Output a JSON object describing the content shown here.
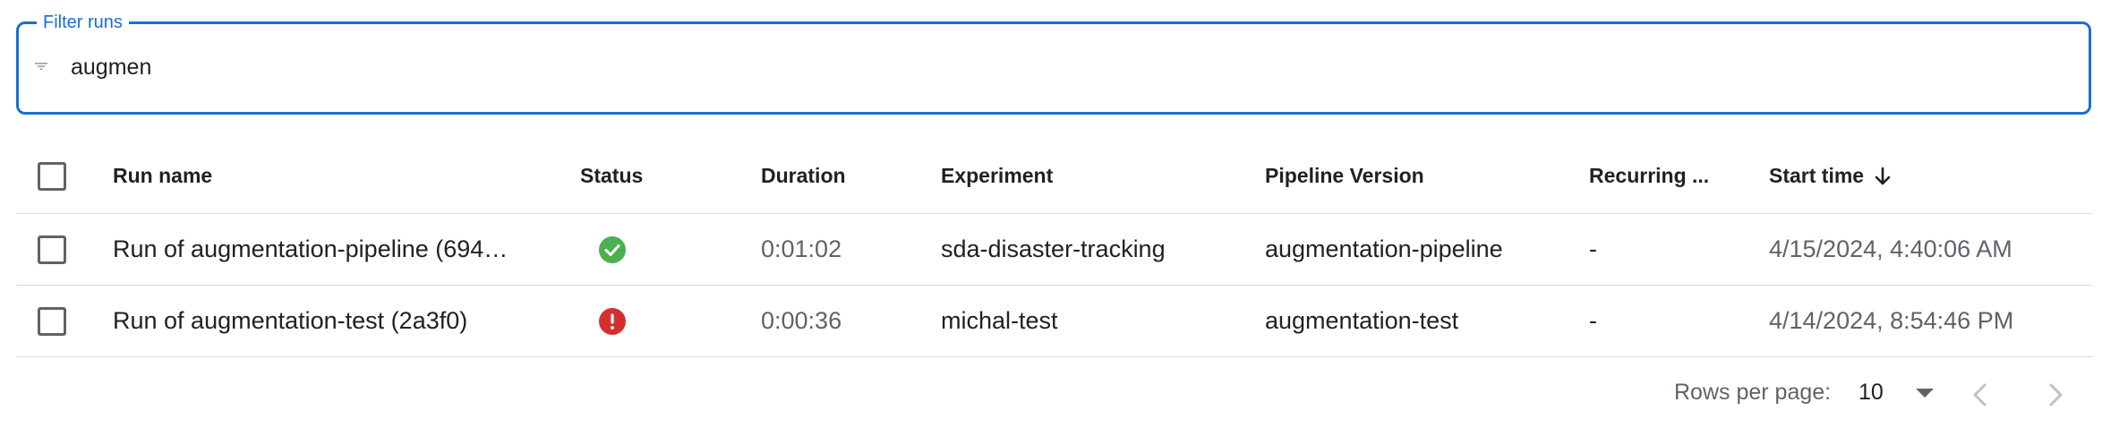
{
  "filter": {
    "label": "Filter runs",
    "value": "augmen"
  },
  "table": {
    "columns": {
      "run_name": "Run name",
      "status": "Status",
      "duration": "Duration",
      "experiment": "Experiment",
      "pipeline_version": "Pipeline Version",
      "recurring": "Recurring ...",
      "start_time": "Start time"
    },
    "sort": {
      "column": "start_time",
      "direction": "descending"
    },
    "rows": [
      {
        "run_name": "Run of augmentation-pipeline (694…",
        "status": "succeeded",
        "duration": "0:01:02",
        "experiment": "sda-disaster-tracking",
        "pipeline_version": "augmentation-pipeline",
        "recurring": "-",
        "start_time": "4/15/2024, 4:40:06 AM"
      },
      {
        "run_name": "Run of augmentation-test (2a3f0)",
        "status": "failed",
        "duration": "0:00:36",
        "experiment": "michal-test",
        "pipeline_version": "augmentation-test",
        "recurring": "-",
        "start_time": "4/14/2024, 8:54:46 PM"
      }
    ]
  },
  "pagination": {
    "rows_per_page_label": "Rows per page:",
    "rows_per_page": "10"
  },
  "colors": {
    "accent": "#1a6fd1",
    "success": "#4caf50",
    "error": "#d32f2f",
    "muted_text": "#5f6368",
    "divider": "#dadce0"
  },
  "icons": {
    "filter": "filter-icon",
    "sort": "arrow-down-icon",
    "success": "check-circle-icon",
    "error": "error-circle-icon",
    "dropdown": "caret-down-icon",
    "prev": "chevron-left-icon",
    "next": "chevron-right-icon"
  }
}
